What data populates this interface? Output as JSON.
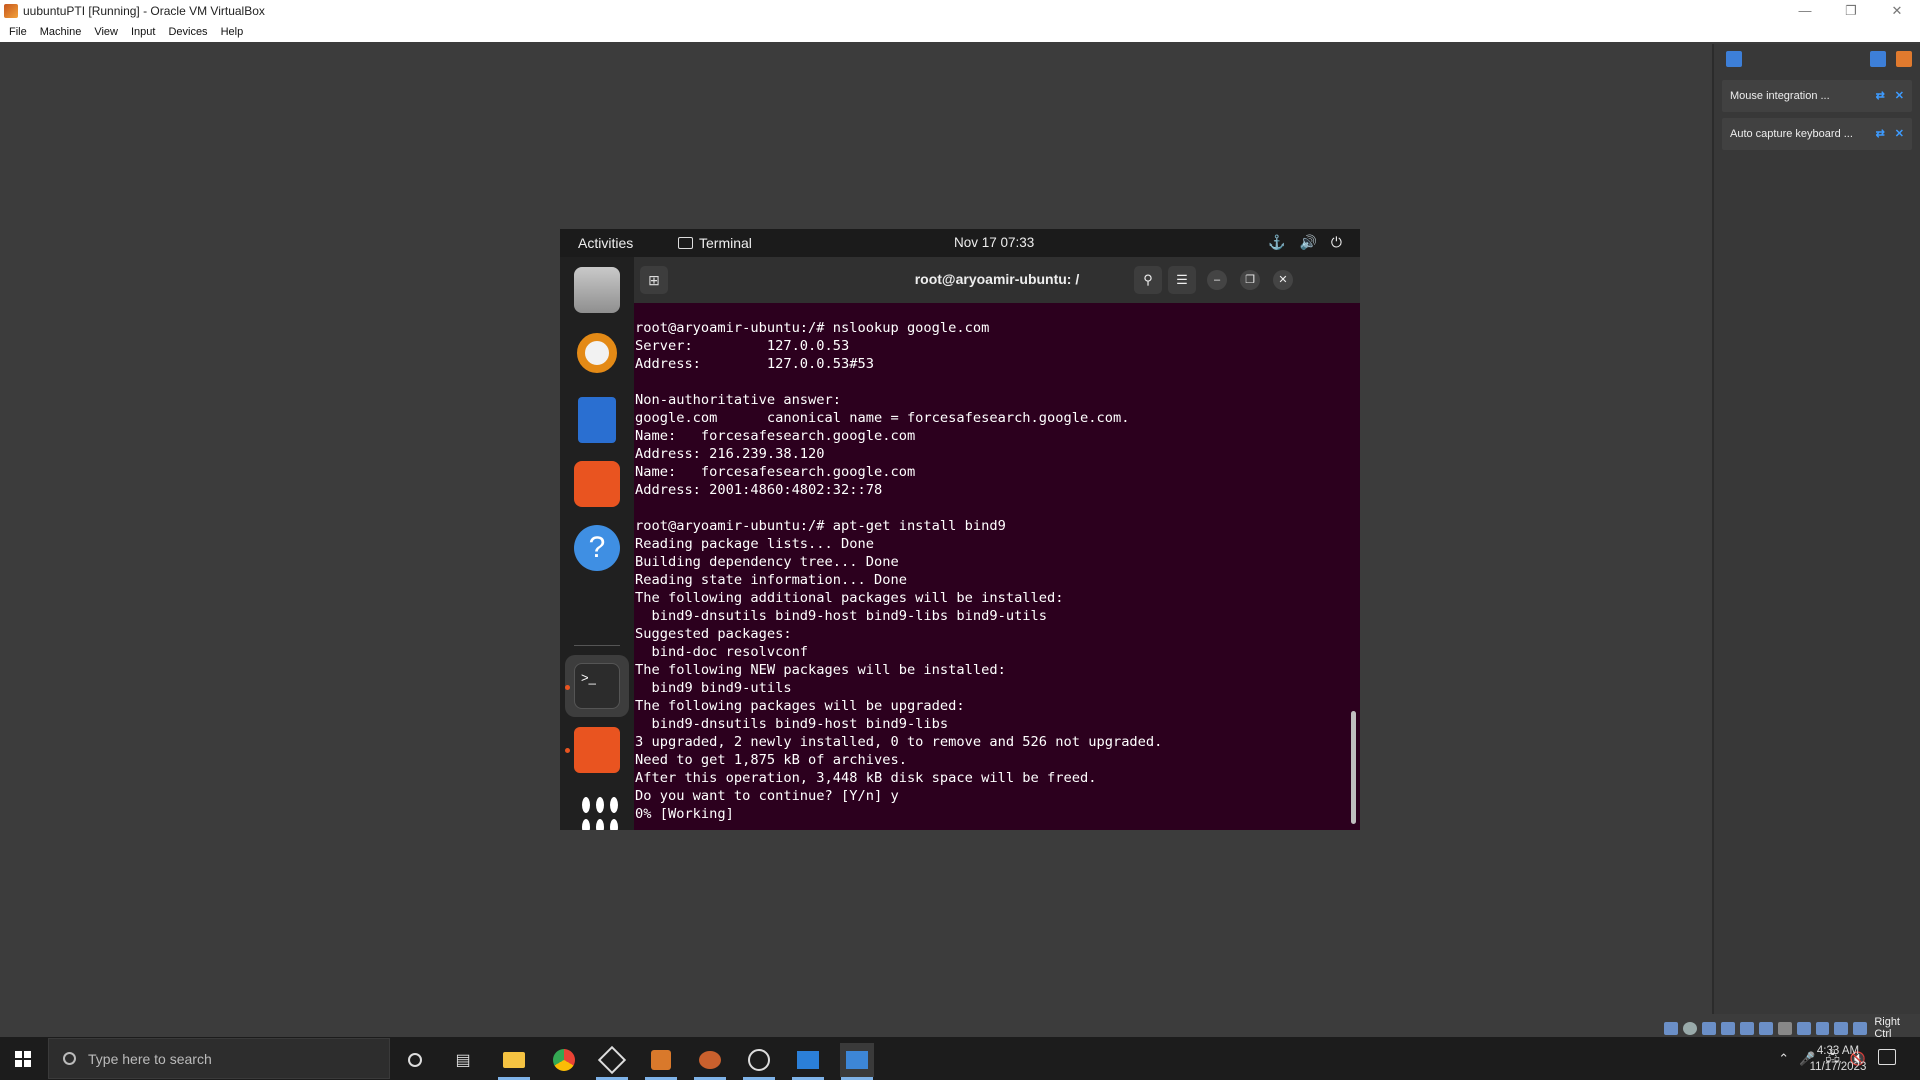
{
  "vbox": {
    "title": "uubuntuPTI [Running] - Oracle VM VirtualBox",
    "menu": [
      "File",
      "Machine",
      "View",
      "Input",
      "Devices",
      "Help"
    ],
    "notifications": [
      {
        "text": "Mouse integration ..."
      },
      {
        "text": "Auto capture keyboard ..."
      }
    ],
    "host_key": "Right Ctrl"
  },
  "gnome": {
    "activities": "Activities",
    "app_name": "Terminal",
    "clock": "Nov 17  07:33"
  },
  "terminal": {
    "title": "root@aryoamir-ubuntu: /",
    "lines": [
      "root@aryoamir-ubuntu:/# nslookup google.com",
      "Server:         127.0.0.53",
      "Address:        127.0.0.53#53",
      "",
      "Non-authoritative answer:",
      "google.com      canonical name = forcesafesearch.google.com.",
      "Name:   forcesafesearch.google.com",
      "Address: 216.239.38.120",
      "Name:   forcesafesearch.google.com",
      "Address: 2001:4860:4802:32::78",
      "",
      "root@aryoamir-ubuntu:/# apt-get install bind9",
      "Reading package lists... Done",
      "Building dependency tree... Done",
      "Reading state information... Done",
      "The following additional packages will be installed:",
      "  bind9-dnsutils bind9-host bind9-libs bind9-utils",
      "Suggested packages:",
      "  bind-doc resolvconf",
      "The following NEW packages will be installed:",
      "  bind9 bind9-utils",
      "The following packages will be upgraded:",
      "  bind9-dnsutils bind9-host bind9-libs",
      "3 upgraded, 2 newly installed, 0 to remove and 526 not upgraded.",
      "Need to get 1,875 kB of archives.",
      "After this operation, 3,448 kB disk space will be freed.",
      "Do you want to continue? [Y/n] y",
      "0% [Working]"
    ]
  },
  "dock": {
    "icons": [
      "files-icon",
      "rhythmbox-icon",
      "writer-icon",
      "app-center-icon",
      "help-icon",
      "terminal-icon",
      "ubuntu-installer-icon",
      "show-apps-icon"
    ]
  },
  "taskbar": {
    "search_placeholder": "Type here to search",
    "time": "4:33 AM",
    "date": "11/17/2023"
  },
  "colors": {
    "terminal_bg": "#2c001e",
    "ubuntu_orange": "#e95420",
    "host_bg": "#3c3c3c"
  }
}
